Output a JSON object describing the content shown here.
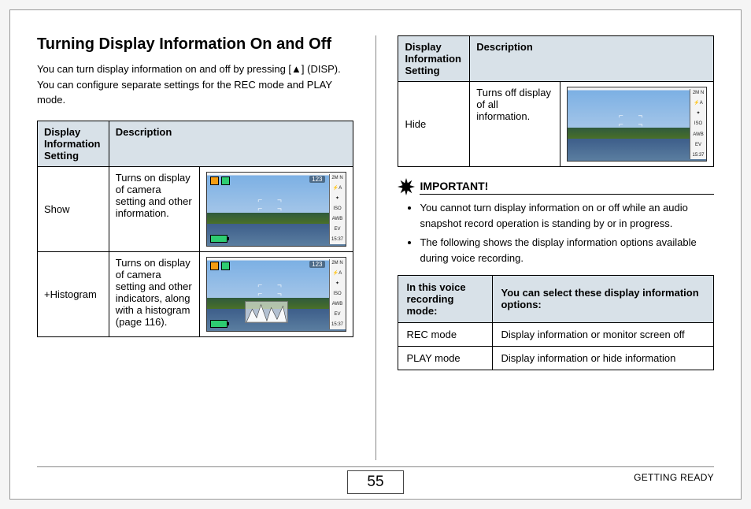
{
  "heading": "Turning Display Information On and Off",
  "intro": "You can turn display information on and off by pressing [▲] (DISP). You can configure separate settings for the REC mode and PLAY mode.",
  "table1": {
    "h1": "Display Information Setting",
    "h2": "Description",
    "rows": [
      {
        "setting": "Show",
        "desc": "Turns on display of camera setting and other information.",
        "thumb": "show"
      },
      {
        "setting": "+Histogram",
        "desc": "Turns on display of camera setting and other indicators, along with a histogram (page 116).",
        "thumb": "histo"
      }
    ]
  },
  "table2": {
    "h1": "Display Information Setting",
    "h2": "Description",
    "rows": [
      {
        "setting": "Hide",
        "desc": "Turns off display of all information.",
        "thumb": "hide"
      }
    ]
  },
  "important": {
    "label": "IMPORTANT!",
    "items": [
      "You cannot turn display information on or off while an audio snapshot record operation is standing by or in progress.",
      "The following shows the display information options available during voice recording."
    ]
  },
  "voiceTable": {
    "h1": "In this voice recording mode:",
    "h2": "You can select these display information options:",
    "rows": [
      {
        "mode": "REC mode",
        "opts": "Display information or monitor screen off"
      },
      {
        "mode": "PLAY mode",
        "opts": "Display information or hide information"
      }
    ]
  },
  "lcd": {
    "count": "123",
    "side": [
      "2M N",
      "⚡A",
      "✦",
      "ISO",
      "AWB",
      "EV",
      "15:37"
    ]
  },
  "footer": {
    "page": "55",
    "section": "GETTING READY"
  }
}
